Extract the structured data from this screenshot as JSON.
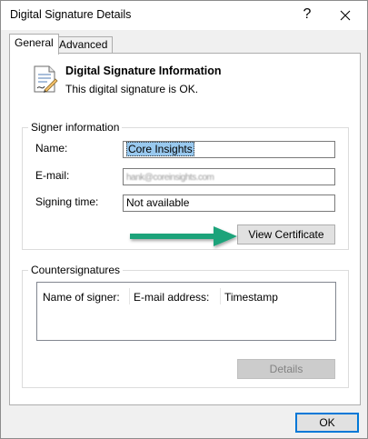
{
  "window": {
    "title": "Digital Signature Details",
    "help_glyph": "?",
    "close_glyph": "✕"
  },
  "tabs": [
    {
      "label": "General",
      "active": true
    },
    {
      "label": "Advanced",
      "active": false
    }
  ],
  "header": {
    "title": "Digital Signature Information",
    "status": "This digital signature is OK."
  },
  "signer": {
    "legend": "Signer information",
    "name_label": "Name:",
    "name_value": "Core Insights",
    "email_label": "E-mail:",
    "email_value": "hank@coreinsights.com",
    "time_label": "Signing time:",
    "time_value": "Not available",
    "view_cert_label": "View Certificate"
  },
  "countersignatures": {
    "legend": "Countersignatures",
    "columns": [
      "Name of signer:",
      "E-mail address:",
      "Timestamp"
    ],
    "rows": [],
    "details_label": "Details"
  },
  "footer": {
    "ok_label": "OK"
  },
  "colors": {
    "arrow": "#1aa37a",
    "selection": "#99c9ef",
    "ok_border": "#0078d7"
  }
}
